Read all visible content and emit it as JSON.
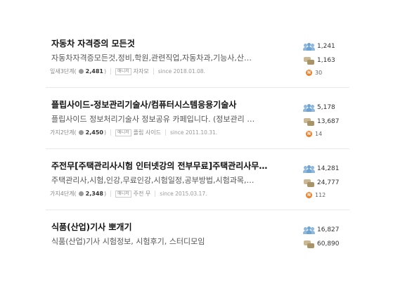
{
  "cafes": [
    {
      "title": "자동차 자격증의 모든것",
      "description": "자동차자격증모든것,정비,학원,관련직업,자동차과,기능사,산…",
      "level": "잎새3단계",
      "level_score": "2,481",
      "manager_label": "매니저",
      "manager": "자자모",
      "since": "since 2018.01.08.",
      "members": "1,241",
      "posts": "1,163",
      "new_badge": "N",
      "new_posts": "30"
    },
    {
      "title": "플립사이드-정보관리기술사/컴퓨터시스템응용기술사",
      "description": "플립사이드 정보처리기술사 정보공유 카페입니다. (정보관리 …",
      "level": "가지2단계",
      "level_score": "2,450",
      "manager_label": "매니저",
      "manager": "플립 사이드",
      "since": "since 2011.10.31.",
      "members": "5,178",
      "posts": "13,687",
      "new_badge": "N",
      "new_posts": "14"
    },
    {
      "title": "주전무[주택관리사시험 인터넷강의 전부무료]주택관리사무…",
      "description": "주택관리사,시험,인강,무료인강,시험일정,공부방법,시험과목,…",
      "level": "가지4단계",
      "level_score": "2,348",
      "manager_label": "매니저",
      "manager": "주전 무",
      "since": "since 2015.03.17.",
      "members": "14,281",
      "posts": "24,777",
      "new_badge": "N",
      "new_posts": "112"
    },
    {
      "title": "식품(산업)기사 뽀개기",
      "description": "식품(산업)기사 시험정보, 시험후기, 스터디모임",
      "members": "16,827",
      "posts": "60,890"
    }
  ],
  "colors": {
    "new_badge": "#f07f2b",
    "members_icon": "#8fb7db",
    "posts_icon": "#b7a276"
  },
  "icons": [
    "members-icon",
    "posts-icon",
    "new-badge-icon",
    "level-gem-icon"
  ]
}
